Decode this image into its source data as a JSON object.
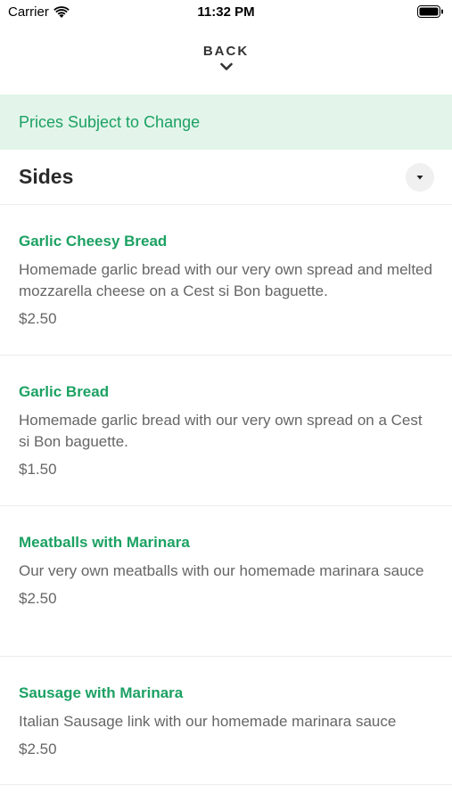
{
  "status_bar": {
    "carrier": "Carrier",
    "time": "11:32 PM"
  },
  "nav": {
    "back_label": "BACK"
  },
  "banner": {
    "text": "Prices Subject to Change"
  },
  "section": {
    "title": "Sides"
  },
  "items": [
    {
      "name": "Garlic Cheesy Bread",
      "description": "Homemade garlic bread with our very own spread and melted mozzarella cheese on a Cest si Bon baguette.",
      "price": "$2.50"
    },
    {
      "name": "Garlic Bread",
      "description": "Homemade garlic bread with our very own spread on a Cest si Bon baguette.",
      "price": "$1.50"
    },
    {
      "name": "Meatballs with Marinara",
      "description": "Our very own meatballs with our homemade marinara sauce",
      "price": "$2.50"
    },
    {
      "name": "Sausage with Marinara",
      "description": "Italian Sausage link with our homemade marinara sauce",
      "price": "$2.50"
    }
  ],
  "colors": {
    "accent_green": "#1ca163",
    "banner_bg": "#e3f5ea"
  }
}
